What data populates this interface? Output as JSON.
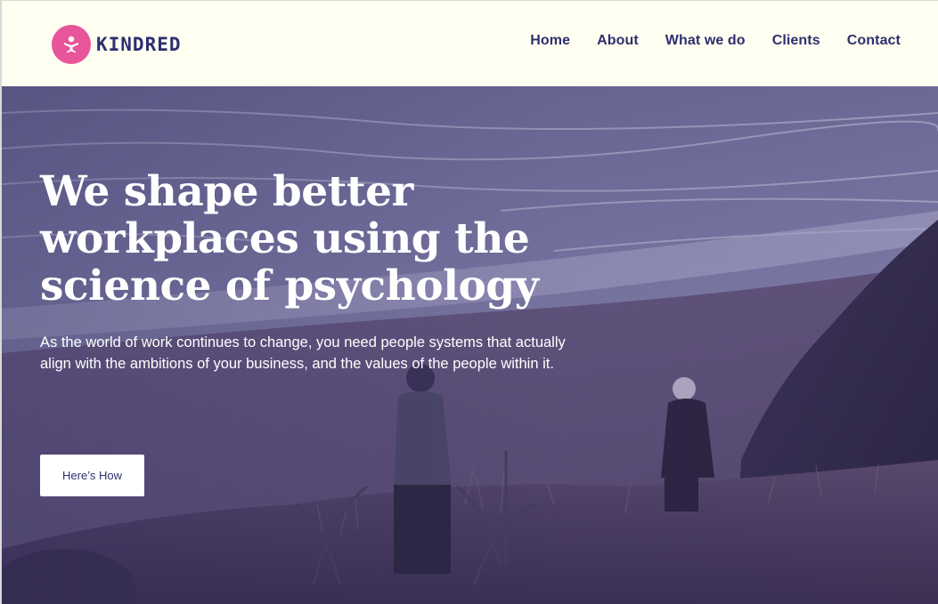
{
  "brand": {
    "name": "KINDRED",
    "accent_color": "#e8559a",
    "text_color": "#2e2f6e",
    "header_background": "#fefef1"
  },
  "nav": {
    "items": [
      {
        "label": "Home"
      },
      {
        "label": "About"
      },
      {
        "label": "What we do"
      },
      {
        "label": "Clients"
      },
      {
        "label": "Contact"
      }
    ]
  },
  "hero": {
    "title": "We shape better workplaces using the science of psychology",
    "subtitle": "As the world of work continues to change, you need people systems that actually align with the ambitions of your business, and the values of the people within it.",
    "cta_label": "Here’s How",
    "image_description_icon": "beach-hillside-photo"
  }
}
